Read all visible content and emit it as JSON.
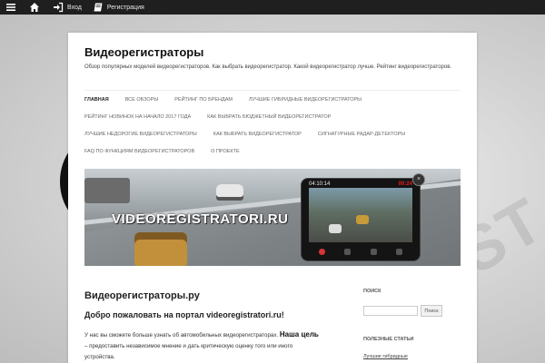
{
  "topbar": {
    "menu_icon": "hamburger-icon",
    "home_icon": "home-icon",
    "login_icon": "sign-in-icon",
    "login_label": "Вход",
    "register_icon": "book-icon",
    "register_label": "Регистрация"
  },
  "site": {
    "title": "Видеорегистраторы",
    "description": "Обзор популярных моделей видеорегистраторов. Как выбрать видеорегистратор. Какой видеорегистратор лучше. Рейтинг видеорегистраторов."
  },
  "nav": {
    "rows": [
      [
        "Главная",
        "Все обзоры",
        "Рейтинг по брендам",
        "Лучшие гибридные видеорегистраторы"
      ],
      [
        "Рейтинг новинок на начало 2017 года",
        "Как выбрать бюджетный видеорегистратор"
      ],
      [
        "Лучшие недорогие видеорегистраторы",
        "Как выбрать видеорегистратор",
        "Сигнатурные радар-детекторы"
      ],
      [
        "FAQ по функциям видеорегистраторов",
        "О проекте"
      ]
    ]
  },
  "banner": {
    "title": "VIDEOREGISTRATORI.RU",
    "device_date": "04:10:14",
    "device_time": "00:24",
    "close_icon": "close-icon"
  },
  "content": {
    "entry_title": "Видеорегистраторы.ру",
    "welcome": "Добро пожаловать на портал videoregistratori.ru!",
    "intro_1": "У нас вы сможете больше узнать об автомобильных видеорегистраторах.",
    "intro_bold": "Наша цель",
    "intro_2": " – предоставить независимое мнение и дать критическую оценку того или иного устройства."
  },
  "sidebar": {
    "search_title": "Поиск",
    "search_value": "",
    "search_button": "Поиск",
    "useful_title": "Полезные статьи",
    "useful_link": "Лучшие гибридные"
  },
  "colors": {
    "topbar_bg": "#1f1f1f",
    "device_time_red": "#e21f1f"
  }
}
